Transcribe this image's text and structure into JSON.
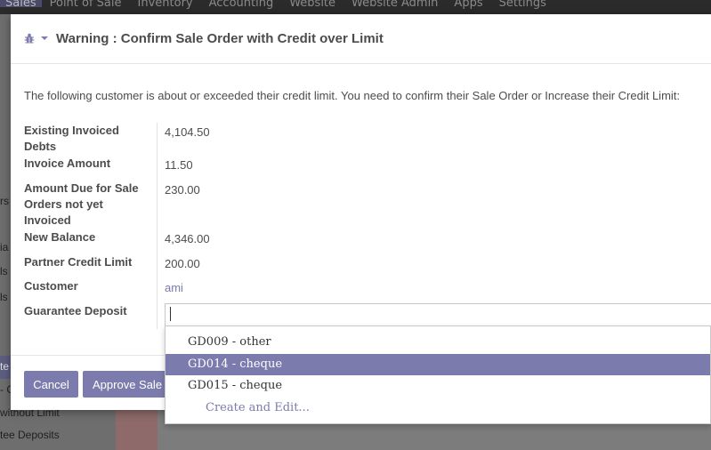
{
  "topnav": {
    "items": [
      "Sales",
      "Point of Sale",
      "Inventory",
      "Accounting",
      "Website",
      "Website Admin",
      "Apps",
      "Settings"
    ]
  },
  "background": {
    "sidebar_fragments": [
      "rs",
      "ia",
      "ls",
      "ls",
      "te",
      "- C",
      "without Limit",
      "tee Deposits"
    ]
  },
  "modal": {
    "title": "Warning : Confirm Sale Order with Credit over Limit",
    "intro": "The following customer is about or exceeded their credit limit. You need to confirm their Sale Order or Increase their Credit Limit:",
    "fields": [
      {
        "label": "Existing Invoiced Debts",
        "value": "4,104.50"
      },
      {
        "label": "Invoice Amount",
        "value": "11.50"
      },
      {
        "label": "Amount Due for Sale Orders not yet Invoiced",
        "value": "230.00"
      },
      {
        "label": "New Balance",
        "value": "4,346.00"
      },
      {
        "label": "Partner Credit Limit",
        "value": "200.00"
      },
      {
        "label": "Customer",
        "value": "ami"
      },
      {
        "label": "Guarantee Deposit",
        "value": ""
      }
    ],
    "buttons": {
      "cancel": "Cancel",
      "approve": "Approve Sale Order"
    }
  },
  "dropdown": {
    "options": [
      "GD009 - other",
      "GD014 - cheque",
      "GD015 - cheque"
    ],
    "selected": "GD014 - cheque",
    "create_label": "Create and Edit..."
  },
  "colors": {
    "accent": "#7c7bad",
    "nav_bg": "#2b2b2b"
  }
}
